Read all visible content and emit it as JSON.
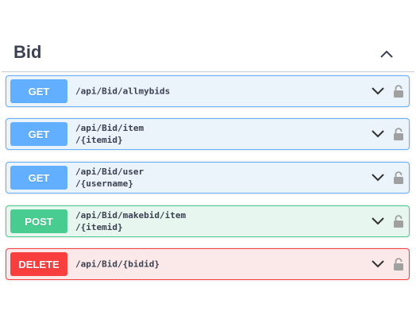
{
  "section": {
    "title": "Bid"
  },
  "operations": [
    {
      "method": "GET",
      "path": "/api/Bid/allmybids"
    },
    {
      "method": "GET",
      "path": "/api/Bid/item\n/{itemid}"
    },
    {
      "method": "GET",
      "path": "/api/Bid/user\n/{username}"
    },
    {
      "method": "POST",
      "path": "/api/Bid/makebid/item\n/{itemid}"
    },
    {
      "method": "DELETE",
      "path": "/api/Bid/{bidid}"
    }
  ],
  "icons": {
    "collapse": "chevron-up-icon",
    "expand": "chevron-down-icon",
    "lock": "lock-icon"
  },
  "colors": {
    "get": "#61affe",
    "post": "#49cc90",
    "delete": "#f93e3e",
    "text": "#3b4151"
  }
}
